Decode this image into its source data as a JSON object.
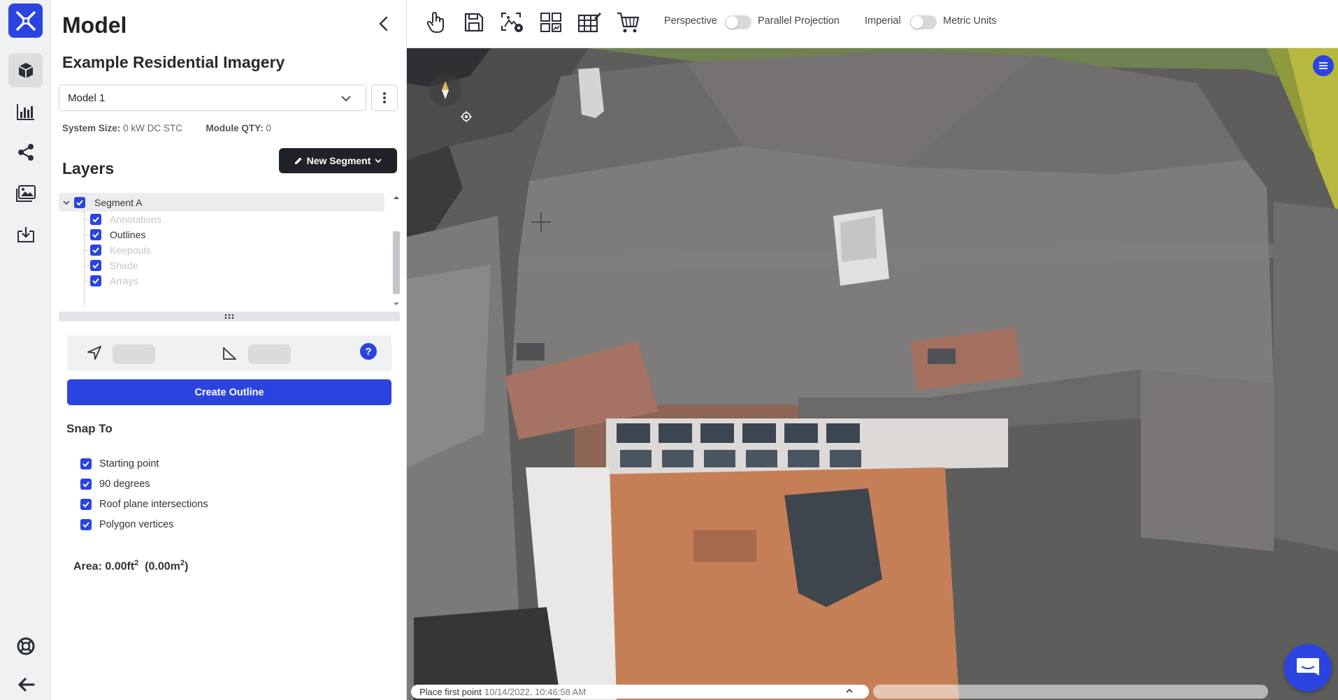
{
  "rail": {
    "items": [
      "logo-icon",
      "model-cube-icon",
      "chart-icon",
      "share-icon",
      "image-gallery-icon",
      "download-icon",
      "support-icon",
      "back-arrow-icon"
    ],
    "accent": "#2b44e0"
  },
  "panel": {
    "title": "Model",
    "project_title": "Example Residential Imagery",
    "model_select": {
      "value": "Model 1"
    },
    "system_size_label": "System Size:",
    "system_size_value": "0 kW DC STC",
    "module_qty_label": "Module QTY:",
    "module_qty_value": "0",
    "layers_title": "Layers",
    "new_segment_label": "New Segment",
    "segment": {
      "label": "Segment A",
      "checked": true
    },
    "layers": [
      {
        "label": "Annotations",
        "checked": true,
        "muted": true
      },
      {
        "label": "Outlines",
        "checked": true,
        "muted": false
      },
      {
        "label": "Keepouts",
        "checked": true,
        "muted": true
      },
      {
        "label": "Shade",
        "checked": true,
        "muted": true
      },
      {
        "label": "Arrays",
        "checked": true,
        "muted": true
      }
    ],
    "help_label": "?",
    "create_outline_label": "Create Outline",
    "snap_title": "Snap To",
    "snap_options": [
      {
        "label": "Starting point",
        "checked": true
      },
      {
        "label": "90 degrees",
        "checked": true
      },
      {
        "label": "Roof plane intersections",
        "checked": true
      },
      {
        "label": "Polygon vertices",
        "checked": true
      }
    ],
    "area": {
      "label": "Area:",
      "imperial": "0.00ft",
      "metric_open": "(0.00m",
      "metric_close": ")",
      "exp": "2"
    }
  },
  "toolbar": {
    "tools": [
      "pan-hand-icon",
      "save-icon",
      "image-settings-icon",
      "grid-layout-icon",
      "table-edit-icon",
      "cart-icon"
    ],
    "perspective_label": "Perspective",
    "parallel_label": "Parallel Projection",
    "imperial_label": "Imperial",
    "metric_label": "Metric Units"
  },
  "status": {
    "message": "Place first point",
    "timestamp": "10/14/2022, 10:46:58 AM"
  }
}
